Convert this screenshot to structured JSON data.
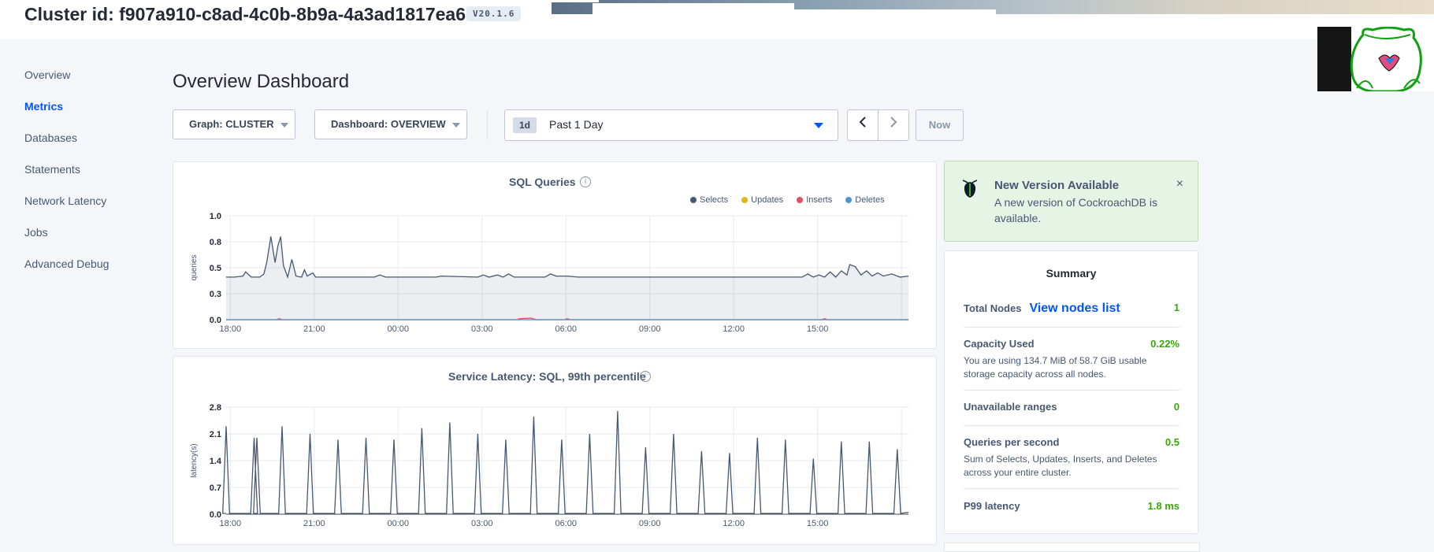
{
  "header": {
    "cluster_title": "Cluster id: f907a910-c8ad-4c0b-8b9a-4a3ad1817ea6",
    "version": "V20.1.6"
  },
  "sidebar": {
    "items": [
      {
        "label": "Overview"
      },
      {
        "label": "Metrics"
      },
      {
        "label": "Databases"
      },
      {
        "label": "Statements"
      },
      {
        "label": "Network Latency"
      },
      {
        "label": "Jobs"
      },
      {
        "label": "Advanced Debug"
      }
    ]
  },
  "main": {
    "page_title": "Overview Dashboard",
    "controls": {
      "graph": "Graph: CLUSTER",
      "dashboard": "Dashboard: OVERVIEW",
      "time_chip": "1d",
      "time_range": "Past 1 Day",
      "prev_icon": "chevron-left-icon",
      "next_icon": "chevron-right-icon",
      "now_label": "Now"
    }
  },
  "alert": {
    "title": "New Version Available",
    "body": "A new version of CockroachDB is available.",
    "close": "×"
  },
  "summary": {
    "title": "Summary",
    "total_nodes": {
      "label": "Total Nodes",
      "link": "View nodes list",
      "value": "1"
    },
    "capacity": {
      "label": "Capacity Used",
      "value": "0.22%",
      "desc": "You are using 134.7 MiB of 58.7 GiB usable storage capacity across all nodes."
    },
    "unavailable": {
      "label": "Unavailable ranges",
      "value": "0"
    },
    "qps": {
      "label": "Queries per second",
      "value": "0.5",
      "desc": "Sum of Selects, Updates, Inserts, and Deletes across your entire cluster."
    },
    "p99": {
      "label": "P99 latency",
      "value": "1.8 ms"
    }
  },
  "colors": {
    "accent": "#0055ff",
    "success": "#37a806",
    "selects": "#475872",
    "updates": "#e2b51b",
    "inserts": "#e0505e",
    "deletes": "#4b97d6"
  },
  "chart_data": [
    {
      "type": "line",
      "title": "SQL Queries",
      "ylabel": "queries",
      "x_ticks": [
        "18:00",
        "21:00",
        "00:00",
        "03:00",
        "06:00",
        "09:00",
        "12:00",
        "15:00"
      ],
      "y_ticks": [
        "0.0",
        "0.3",
        "0.5",
        "0.8",
        "1.0"
      ],
      "ylim": [
        0,
        1.0
      ],
      "xlim_hours": [
        0,
        24.4
      ],
      "series": [
        {
          "name": "Selects",
          "color": "#475872",
          "values": [
            [
              0,
              0.41
            ],
            [
              0.3,
              0.41
            ],
            [
              0.6,
              0.42
            ],
            [
              0.7,
              0.46
            ],
            [
              0.9,
              0.41
            ],
            [
              1.2,
              0.41
            ],
            [
              1.35,
              0.44
            ],
            [
              1.45,
              0.55
            ],
            [
              1.6,
              0.8
            ],
            [
              1.75,
              0.55
            ],
            [
              1.85,
              0.71
            ],
            [
              1.95,
              0.8
            ],
            [
              2.05,
              0.52
            ],
            [
              2.2,
              0.41
            ],
            [
              2.35,
              0.58
            ],
            [
              2.5,
              0.42
            ],
            [
              2.7,
              0.41
            ],
            [
              2.8,
              0.48
            ],
            [
              2.9,
              0.42
            ],
            [
              3.1,
              0.45
            ],
            [
              3.2,
              0.41
            ],
            [
              3.5,
              0.41
            ],
            [
              5.3,
              0.41
            ],
            [
              5.5,
              0.43
            ],
            [
              5.7,
              0.41
            ],
            [
              7.5,
              0.41
            ],
            [
              7.7,
              0.42
            ],
            [
              9.0,
              0.41
            ],
            [
              9.2,
              0.43
            ],
            [
              9.4,
              0.41
            ],
            [
              9.7,
              0.43
            ],
            [
              9.9,
              0.41
            ],
            [
              10.1,
              0.44
            ],
            [
              10.3,
              0.41
            ],
            [
              11.4,
              0.41
            ],
            [
              11.6,
              0.44
            ],
            [
              11.8,
              0.42
            ],
            [
              12.2,
              0.42
            ],
            [
              12.6,
              0.41
            ],
            [
              14.0,
              0.41
            ],
            [
              17.5,
              0.41
            ],
            [
              19.0,
              0.41
            ],
            [
              20.6,
              0.41
            ],
            [
              20.8,
              0.44
            ],
            [
              21.0,
              0.41
            ],
            [
              21.2,
              0.43
            ],
            [
              21.4,
              0.41
            ],
            [
              21.6,
              0.46
            ],
            [
              21.8,
              0.41
            ],
            [
              22.0,
              0.47
            ],
            [
              22.2,
              0.43
            ],
            [
              22.3,
              0.53
            ],
            [
              22.5,
              0.51
            ],
            [
              22.7,
              0.43
            ],
            [
              22.9,
              0.47
            ],
            [
              23.1,
              0.42
            ],
            [
              23.3,
              0.45
            ],
            [
              23.5,
              0.42
            ],
            [
              23.8,
              0.44
            ],
            [
              24.1,
              0.41
            ],
            [
              24.4,
              0.42
            ]
          ]
        },
        {
          "name": "Updates",
          "color": "#e2b51b",
          "values": [
            [
              0,
              0.0
            ],
            [
              24.4,
              0.0
            ]
          ]
        },
        {
          "name": "Inserts",
          "color": "#e0505e",
          "values": [
            [
              0,
              0
            ],
            [
              1.8,
              0
            ],
            [
              1.9,
              0.01
            ],
            [
              2.0,
              0
            ],
            [
              10.4,
              0
            ],
            [
              10.5,
              0.01
            ],
            [
              10.9,
              0.015
            ],
            [
              11.1,
              0
            ],
            [
              12.1,
              0
            ],
            [
              12.2,
              0.01
            ],
            [
              12.3,
              0
            ],
            [
              21.3,
              0
            ],
            [
              21.4,
              0.01
            ],
            [
              21.5,
              0
            ],
            [
              24.4,
              0
            ]
          ]
        },
        {
          "name": "Deletes",
          "color": "#4b97d6",
          "values": [
            [
              0,
              0.0
            ],
            [
              24.4,
              0.0
            ]
          ]
        }
      ]
    },
    {
      "type": "line",
      "title": "Service Latency: SQL, 99th percentile",
      "ylabel": "latency(s)",
      "x_ticks": [
        "18:00",
        "21:00",
        "00:00",
        "03:00",
        "06:00",
        "09:00",
        "12:00",
        "15:00"
      ],
      "y_ticks": [
        "0.0",
        "0.7",
        "1.4",
        "2.1",
        "2.8"
      ],
      "ylim": [
        0,
        2.8
      ],
      "xlim_hours": [
        0,
        24.4
      ],
      "series": [
        {
          "name": "",
          "color": "#475872",
          "spikes": [
            [
              0,
              2.3
            ],
            [
              1.0,
              2.0
            ],
            [
              1.1,
              2.0
            ],
            [
              2.0,
              2.3
            ],
            [
              3.0,
              2.1
            ],
            [
              4.0,
              1.95
            ],
            [
              5.0,
              2.0
            ],
            [
              6.0,
              1.95
            ],
            [
              7.0,
              2.25
            ],
            [
              8.0,
              2.4
            ],
            [
              9.0,
              2.1
            ],
            [
              10.0,
              1.95
            ],
            [
              11.0,
              2.55
            ],
            [
              12.0,
              1.95
            ],
            [
              13.0,
              2.1
            ],
            [
              14.0,
              2.7
            ],
            [
              15.0,
              1.75
            ],
            [
              16.0,
              2.1
            ],
            [
              17.0,
              1.65
            ],
            [
              18.0,
              1.6
            ],
            [
              19.0,
              2.0
            ],
            [
              20.0,
              1.95
            ],
            [
              21.0,
              1.45
            ],
            [
              22.0,
              1.9
            ],
            [
              23.0,
              1.9
            ],
            [
              24.0,
              1.7
            ]
          ]
        }
      ]
    }
  ]
}
